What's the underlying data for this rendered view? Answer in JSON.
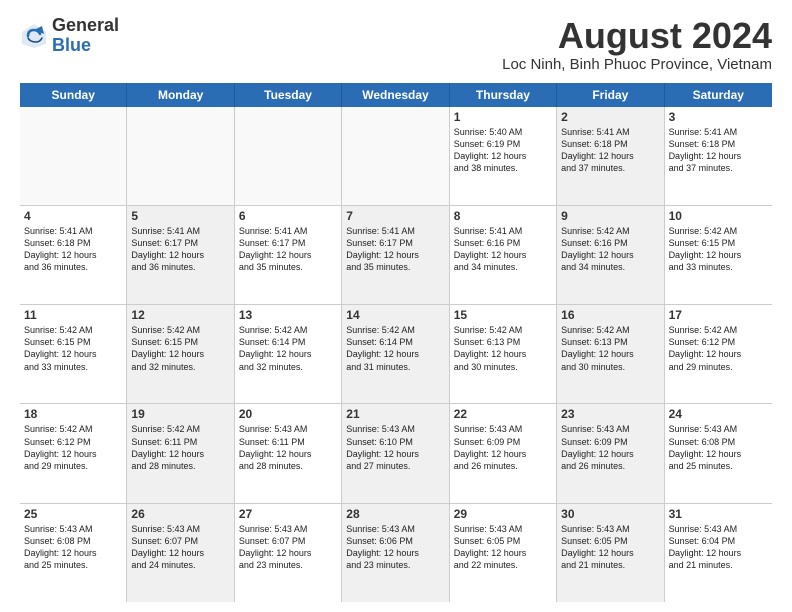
{
  "logo": {
    "general": "General",
    "blue": "Blue"
  },
  "title": "August 2024",
  "location": "Loc Ninh, Binh Phuoc Province, Vietnam",
  "header_days": [
    "Sunday",
    "Monday",
    "Tuesday",
    "Wednesday",
    "Thursday",
    "Friday",
    "Saturday"
  ],
  "weeks": [
    [
      {
        "day": "",
        "text": "",
        "shaded": true,
        "empty": true
      },
      {
        "day": "",
        "text": "",
        "shaded": true,
        "empty": true
      },
      {
        "day": "",
        "text": "",
        "shaded": true,
        "empty": true
      },
      {
        "day": "",
        "text": "",
        "shaded": true,
        "empty": true
      },
      {
        "day": "1",
        "text": "Sunrise: 5:40 AM\nSunset: 6:19 PM\nDaylight: 12 hours\nand 38 minutes.",
        "shaded": false,
        "empty": false
      },
      {
        "day": "2",
        "text": "Sunrise: 5:41 AM\nSunset: 6:18 PM\nDaylight: 12 hours\nand 37 minutes.",
        "shaded": true,
        "empty": false
      },
      {
        "day": "3",
        "text": "Sunrise: 5:41 AM\nSunset: 6:18 PM\nDaylight: 12 hours\nand 37 minutes.",
        "shaded": false,
        "empty": false
      }
    ],
    [
      {
        "day": "4",
        "text": "Sunrise: 5:41 AM\nSunset: 6:18 PM\nDaylight: 12 hours\nand 36 minutes.",
        "shaded": false,
        "empty": false
      },
      {
        "day": "5",
        "text": "Sunrise: 5:41 AM\nSunset: 6:17 PM\nDaylight: 12 hours\nand 36 minutes.",
        "shaded": true,
        "empty": false
      },
      {
        "day": "6",
        "text": "Sunrise: 5:41 AM\nSunset: 6:17 PM\nDaylight: 12 hours\nand 35 minutes.",
        "shaded": false,
        "empty": false
      },
      {
        "day": "7",
        "text": "Sunrise: 5:41 AM\nSunset: 6:17 PM\nDaylight: 12 hours\nand 35 minutes.",
        "shaded": true,
        "empty": false
      },
      {
        "day": "8",
        "text": "Sunrise: 5:41 AM\nSunset: 6:16 PM\nDaylight: 12 hours\nand 34 minutes.",
        "shaded": false,
        "empty": false
      },
      {
        "day": "9",
        "text": "Sunrise: 5:42 AM\nSunset: 6:16 PM\nDaylight: 12 hours\nand 34 minutes.",
        "shaded": true,
        "empty": false
      },
      {
        "day": "10",
        "text": "Sunrise: 5:42 AM\nSunset: 6:15 PM\nDaylight: 12 hours\nand 33 minutes.",
        "shaded": false,
        "empty": false
      }
    ],
    [
      {
        "day": "11",
        "text": "Sunrise: 5:42 AM\nSunset: 6:15 PM\nDaylight: 12 hours\nand 33 minutes.",
        "shaded": false,
        "empty": false
      },
      {
        "day": "12",
        "text": "Sunrise: 5:42 AM\nSunset: 6:15 PM\nDaylight: 12 hours\nand 32 minutes.",
        "shaded": true,
        "empty": false
      },
      {
        "day": "13",
        "text": "Sunrise: 5:42 AM\nSunset: 6:14 PM\nDaylight: 12 hours\nand 32 minutes.",
        "shaded": false,
        "empty": false
      },
      {
        "day": "14",
        "text": "Sunrise: 5:42 AM\nSunset: 6:14 PM\nDaylight: 12 hours\nand 31 minutes.",
        "shaded": true,
        "empty": false
      },
      {
        "day": "15",
        "text": "Sunrise: 5:42 AM\nSunset: 6:13 PM\nDaylight: 12 hours\nand 30 minutes.",
        "shaded": false,
        "empty": false
      },
      {
        "day": "16",
        "text": "Sunrise: 5:42 AM\nSunset: 6:13 PM\nDaylight: 12 hours\nand 30 minutes.",
        "shaded": true,
        "empty": false
      },
      {
        "day": "17",
        "text": "Sunrise: 5:42 AM\nSunset: 6:12 PM\nDaylight: 12 hours\nand 29 minutes.",
        "shaded": false,
        "empty": false
      }
    ],
    [
      {
        "day": "18",
        "text": "Sunrise: 5:42 AM\nSunset: 6:12 PM\nDaylight: 12 hours\nand 29 minutes.",
        "shaded": false,
        "empty": false
      },
      {
        "day": "19",
        "text": "Sunrise: 5:42 AM\nSunset: 6:11 PM\nDaylight: 12 hours\nand 28 minutes.",
        "shaded": true,
        "empty": false
      },
      {
        "day": "20",
        "text": "Sunrise: 5:43 AM\nSunset: 6:11 PM\nDaylight: 12 hours\nand 28 minutes.",
        "shaded": false,
        "empty": false
      },
      {
        "day": "21",
        "text": "Sunrise: 5:43 AM\nSunset: 6:10 PM\nDaylight: 12 hours\nand 27 minutes.",
        "shaded": true,
        "empty": false
      },
      {
        "day": "22",
        "text": "Sunrise: 5:43 AM\nSunset: 6:09 PM\nDaylight: 12 hours\nand 26 minutes.",
        "shaded": false,
        "empty": false
      },
      {
        "day": "23",
        "text": "Sunrise: 5:43 AM\nSunset: 6:09 PM\nDaylight: 12 hours\nand 26 minutes.",
        "shaded": true,
        "empty": false
      },
      {
        "day": "24",
        "text": "Sunrise: 5:43 AM\nSunset: 6:08 PM\nDaylight: 12 hours\nand 25 minutes.",
        "shaded": false,
        "empty": false
      }
    ],
    [
      {
        "day": "25",
        "text": "Sunrise: 5:43 AM\nSunset: 6:08 PM\nDaylight: 12 hours\nand 25 minutes.",
        "shaded": false,
        "empty": false
      },
      {
        "day": "26",
        "text": "Sunrise: 5:43 AM\nSunset: 6:07 PM\nDaylight: 12 hours\nand 24 minutes.",
        "shaded": true,
        "empty": false
      },
      {
        "day": "27",
        "text": "Sunrise: 5:43 AM\nSunset: 6:07 PM\nDaylight: 12 hours\nand 23 minutes.",
        "shaded": false,
        "empty": false
      },
      {
        "day": "28",
        "text": "Sunrise: 5:43 AM\nSunset: 6:06 PM\nDaylight: 12 hours\nand 23 minutes.",
        "shaded": true,
        "empty": false
      },
      {
        "day": "29",
        "text": "Sunrise: 5:43 AM\nSunset: 6:05 PM\nDaylight: 12 hours\nand 22 minutes.",
        "shaded": false,
        "empty": false
      },
      {
        "day": "30",
        "text": "Sunrise: 5:43 AM\nSunset: 6:05 PM\nDaylight: 12 hours\nand 21 minutes.",
        "shaded": true,
        "empty": false
      },
      {
        "day": "31",
        "text": "Sunrise: 5:43 AM\nSunset: 6:04 PM\nDaylight: 12 hours\nand 21 minutes.",
        "shaded": false,
        "empty": false
      }
    ]
  ]
}
